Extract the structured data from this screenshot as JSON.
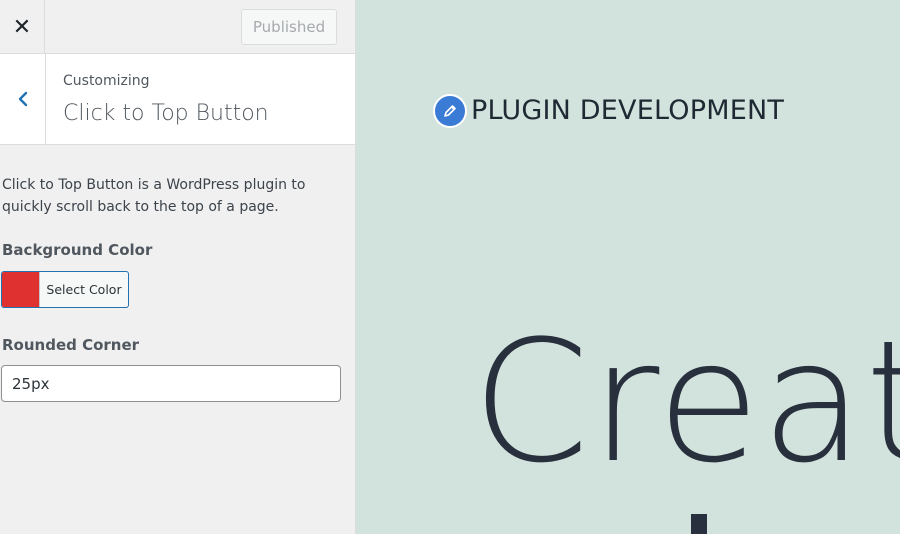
{
  "topbar": {
    "close_symbol": "✕",
    "published_label": "Published"
  },
  "section": {
    "customizing_label": "Customizing",
    "title": "Click to Top Button",
    "description": "Click to Top Button is a WordPress plugin to quickly scroll back to the top of a page."
  },
  "controls": {
    "background_color": {
      "label": "Background Color",
      "button_label": "Select Color",
      "value": "#e03131"
    },
    "rounded_corner": {
      "label": "Rounded Corner",
      "value": "25px"
    }
  },
  "preview": {
    "site_title": "PLUGIN DEVELOPMENT",
    "hero_text": "Create"
  },
  "icons": {
    "close": "close-icon",
    "back": "chevron-left-icon",
    "logo": "pencil-icon"
  },
  "colors": {
    "accent": "#2271b1",
    "swatch": "#e03131",
    "preview_bg": "#d2e3dd"
  }
}
